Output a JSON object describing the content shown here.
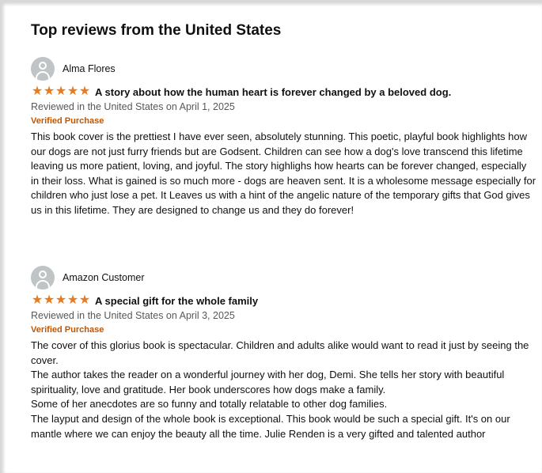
{
  "section": {
    "title": "Top reviews from the United States"
  },
  "colors": {
    "star": "#e87b1e",
    "verified": "#c45500",
    "date": "#565959",
    "avatar": "#bfc4c6"
  },
  "reviews": [
    {
      "author": "Alma Flores",
      "rating": 5,
      "title": "A story about how the human heart is forever changed by a beloved dog.",
      "date": "Reviewed in the United States on April 1, 2025",
      "badge": "Verified Purchase",
      "body": "This book cover is the prettiest I have ever seen, absolutely stunning. This poetic, playful book highlights how our dogs are not just furry friends but are Godsent. Children can see how a dog's love transcend this lifetime leaving us more patient, loving, and joyful. The story highlighs how hearts can be forever changed, especially in their loss. What is gained is so much more - dogs are heaven sent. It is a wholesome message especially for children who just lose a pet. It Leaves us with a hint of the angelic nature of the temporary gifts that God gives us in this lifetime. They are designed to change us and they do forever!"
    },
    {
      "author": "Amazon Customer",
      "rating": 5,
      "title": "A special gift for the whole family",
      "date": "Reviewed in the United States on April 3, 2025",
      "badge": "Verified Purchase",
      "body": "The cover of this glorius book is spectacular. Children and adults alike would want to read it just by seeing the cover.\nThe author takes the reader on a wonderful journey with her dog, Demi. She tells her story with beautiful spirituality, love and gratitude. Her book underscores how dogs make a family.\nSome of her anecdotes are so funny and totally relatable to other dog families.\nThe layput and design of the whole book is exceptional. This book would be such a special gift. It's on our mantle where we can enjoy the beauty all the time. Julie Renden is a very gifted and talented author"
    }
  ]
}
